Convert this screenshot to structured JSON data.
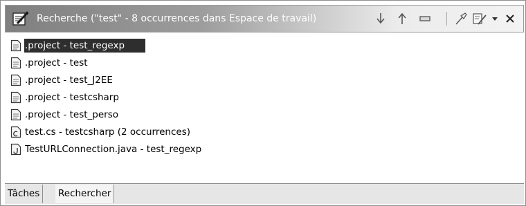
{
  "window": {
    "title": "Recherche (\"test\" - 8 occurrences dans Espace de travail)",
    "icons": {
      "title": "search-view-icon",
      "next": "arrow-down-icon",
      "previous": "arrow-up-icon",
      "remove": "remove-icon",
      "pin": "pin-icon",
      "history": "search-history-icon",
      "menu": "view-menu-chevron-icon",
      "close": "close-icon"
    }
  },
  "results": [
    {
      "label": ".project - test_regexp",
      "icon": "text-file-icon",
      "selected": true
    },
    {
      "label": ".project - test",
      "icon": "text-file-icon"
    },
    {
      "label": ".project - test_J2EE",
      "icon": "text-file-icon"
    },
    {
      "label": ".project - testcsharp",
      "icon": "text-file-icon"
    },
    {
      "label": ".project - test_perso",
      "icon": "text-file-icon"
    },
    {
      "label": "test.cs - testcsharp (2 occurrences)",
      "icon": "csharp-file-icon"
    },
    {
      "label": "TestURLConnection.java - test_regexp",
      "icon": "java-file-icon"
    }
  ],
  "tabs": [
    {
      "label": "Tâches"
    },
    {
      "label": "Rechercher",
      "active": true
    }
  ],
  "colors": {
    "selection": "#2e2e2e",
    "title_text": "#ffffff"
  }
}
